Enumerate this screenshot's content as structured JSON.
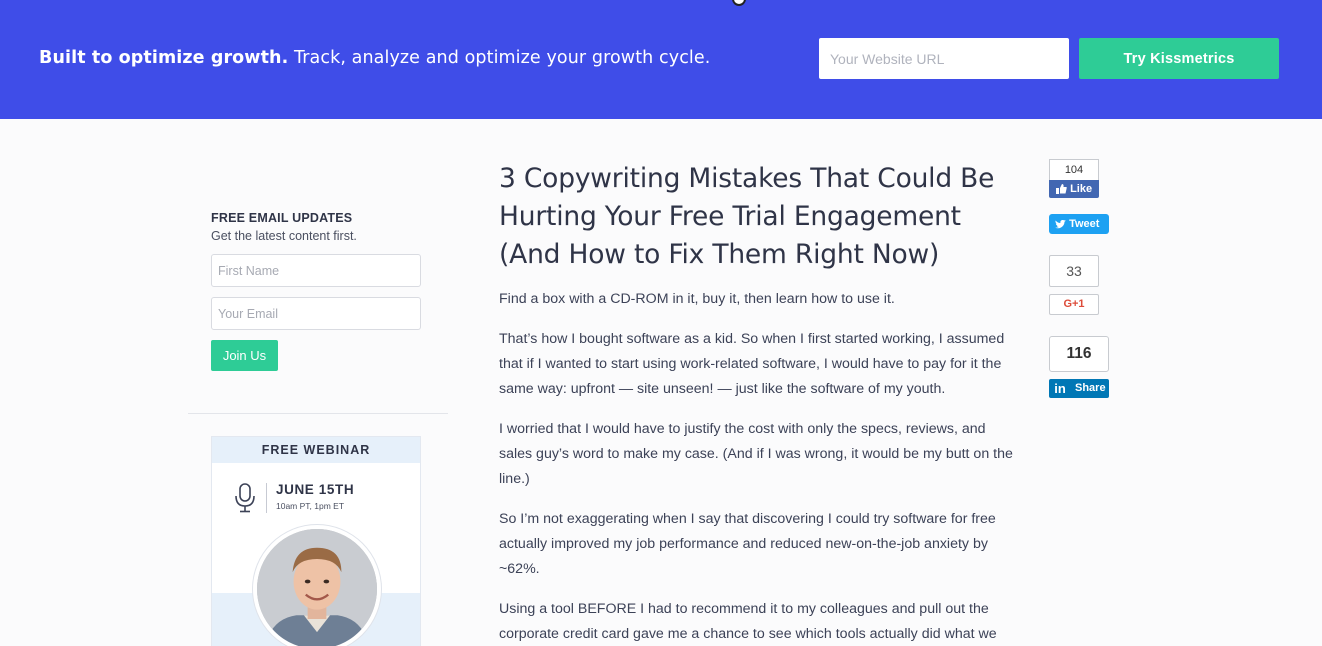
{
  "banner": {
    "headline_bold": "Built to optimize growth.",
    "headline_rest": " Track, analyze and optimize your growth cycle.",
    "url_placeholder": "Your Website URL",
    "cta_label": "Try Kissmetrics",
    "background_color": "#3f4de8",
    "cta_color": "#2ecc96"
  },
  "sidebar": {
    "signup": {
      "title": "FREE EMAIL UPDATES",
      "subtitle": "Get the latest content first.",
      "first_name_placeholder": "First Name",
      "email_placeholder": "Your Email",
      "submit_label": "Join Us"
    },
    "webinar": {
      "heading": "FREE WEBINAR",
      "date": "JUNE 15TH",
      "times": "10am PT, 1pm ET",
      "icon": "microphone-icon"
    }
  },
  "article": {
    "title": "3 Copywriting Mistakes That Could Be Hurting Your Free Trial Engagement (And How to Fix Them Right Now)",
    "paragraphs": [
      "Find a box with a CD-ROM in it, buy it, then learn how to use it.",
      "That’s how I bought software as a kid. So when I first started working, I assumed that if I wanted to start using work-related software, I would have to pay for it the same way: upfront — site unseen! — just like the software of my youth.",
      "I worried that I would have to justify the cost with only the specs, reviews, and sales guy’s word to make my case. (And if I was wrong, it would be my butt on the line.)",
      "So I’m not exaggerating when I say that discovering I could try software for free actually improved my job performance and reduced new-on-the-job anxiety by ~62%.",
      "Using a tool BEFORE I had to recommend it to my colleagues and pull out the corporate credit card gave me a chance to see which tools actually did what we"
    ]
  },
  "share": {
    "facebook": {
      "count": "104",
      "label": "Like",
      "color": "#4267b2"
    },
    "twitter": {
      "label": "Tweet",
      "color": "#1da1f2"
    },
    "googleplus": {
      "count": "33",
      "label": "G+1",
      "color": "#dd4b39"
    },
    "linkedin": {
      "count": "116",
      "label": "Share",
      "color": "#0077b5"
    }
  }
}
